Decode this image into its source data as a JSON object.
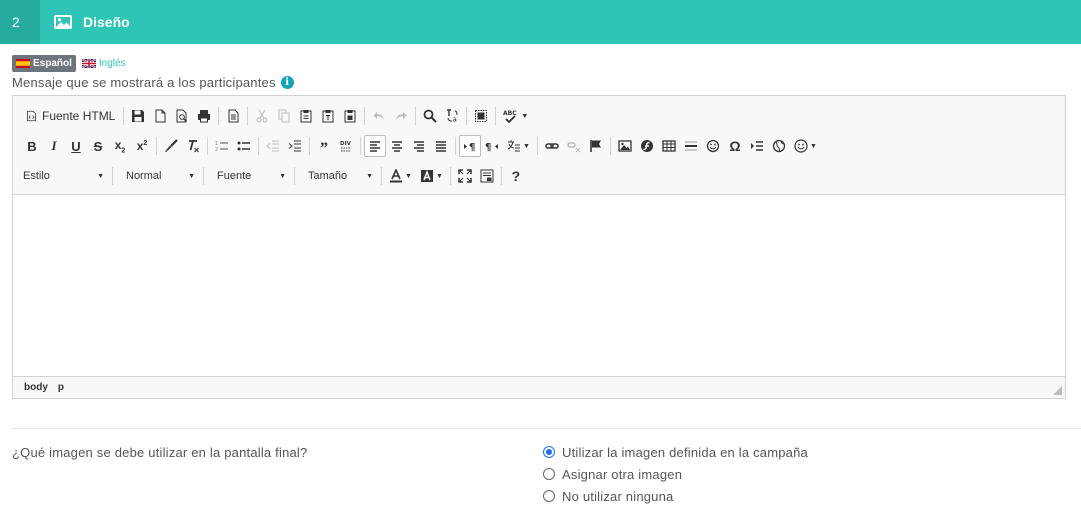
{
  "header": {
    "step_number": "2",
    "title": "Diseño",
    "icon": "image-icon",
    "color": "#2ec4b6"
  },
  "languages": [
    {
      "label": "Español",
      "flag": "spain-flag-icon",
      "active": true
    },
    {
      "label": "Inglés",
      "flag": "uk-flag-icon",
      "active": false
    }
  ],
  "message_label": "Mensaje que se mostrará a los participantes",
  "editor": {
    "toolbar": {
      "source_label": "Fuente HTML",
      "combos": {
        "style": "Estilo",
        "format": "Normal",
        "font": "Fuente",
        "size": "Tamaño"
      }
    },
    "statusbar": {
      "path": [
        "body",
        "p"
      ]
    }
  },
  "final_screen": {
    "question": "¿Qué imagen se debe utilizar en la pantalla final?",
    "options": [
      {
        "label": "Utilizar la imagen definida en la campaña",
        "checked": true
      },
      {
        "label": "Asignar otra imagen",
        "checked": false
      },
      {
        "label": "No utilizar ninguna",
        "checked": false
      }
    ]
  }
}
